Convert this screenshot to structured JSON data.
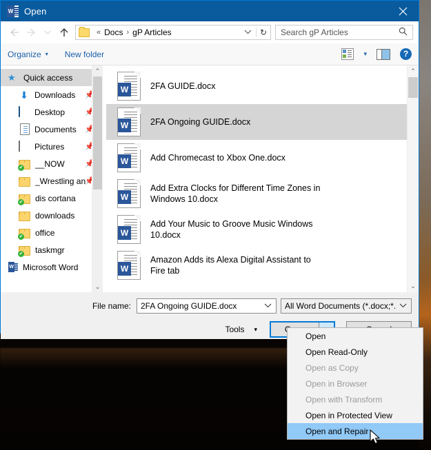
{
  "window": {
    "title": "Open",
    "app_icon": "word-icon",
    "close_icon": "close-icon"
  },
  "address_bar": {
    "back_icon": "back-arrow-icon",
    "forward_icon": "forward-arrow-icon",
    "recent_icon": "chevron-down-icon",
    "up_icon": "up-arrow-icon",
    "folder_icon": "folder-icon",
    "overflow": "«",
    "crumbs": [
      "Docs",
      "gP Articles"
    ],
    "separator": "›",
    "dropdown_icon": "chevron-down-icon",
    "refresh_icon": "refresh-icon",
    "refresh_glyph": "↻"
  },
  "search": {
    "placeholder": "Search gP Articles",
    "icon": "search-icon"
  },
  "command_bar": {
    "organize": "Organize",
    "new_folder": "New folder",
    "view_icon": "view-options-icon",
    "view_caret": "▾",
    "preview_pane_icon": "preview-pane-icon",
    "help_icon": "help-icon",
    "help_glyph": "?"
  },
  "sidebar": {
    "items": [
      {
        "label": "Quick access",
        "icon": "pin-star-icon",
        "selected": true,
        "indent": false,
        "pinned": false
      },
      {
        "label": "Downloads",
        "icon": "download-icon",
        "selected": false,
        "indent": true,
        "pinned": true
      },
      {
        "label": "Desktop",
        "icon": "desktop-icon",
        "selected": false,
        "indent": true,
        "pinned": true
      },
      {
        "label": "Documents",
        "icon": "documents-icon",
        "selected": false,
        "indent": true,
        "pinned": true
      },
      {
        "label": "Pictures",
        "icon": "pictures-icon",
        "selected": false,
        "indent": true,
        "pinned": true
      },
      {
        "label": "__NOW",
        "icon": "folder-sync-icon",
        "selected": false,
        "indent": true,
        "pinned": true
      },
      {
        "label": "_Wrestling an",
        "icon": "folder-icon",
        "selected": false,
        "indent": true,
        "pinned": true
      },
      {
        "label": "dis cortana",
        "icon": "folder-sync-icon",
        "selected": false,
        "indent": true,
        "pinned": false
      },
      {
        "label": "downloads",
        "icon": "folder-icon",
        "selected": false,
        "indent": true,
        "pinned": false
      },
      {
        "label": "office",
        "icon": "folder-sync-icon",
        "selected": false,
        "indent": true,
        "pinned": false
      },
      {
        "label": "taskmgr",
        "icon": "folder-sync-icon",
        "selected": false,
        "indent": true,
        "pinned": false
      },
      {
        "label": "Microsoft Word",
        "icon": "word-icon",
        "selected": false,
        "indent": false,
        "pinned": false
      }
    ],
    "pin_glyph": "📌",
    "scroll_up_glyph": "⌃",
    "scroll_down_glyph": "⌄"
  },
  "file_list": {
    "files": [
      {
        "name": "2FA GUIDE.docx",
        "icon": "word-document-icon",
        "selected": false
      },
      {
        "name": "2FA Ongoing GUIDE.docx",
        "icon": "word-document-icon",
        "selected": true
      },
      {
        "name": "Add Chromecast to Xbox One.docx",
        "icon": "word-document-icon",
        "selected": false
      },
      {
        "name": "Add Extra Clocks for Different Time Zones in Windows 10.docx",
        "icon": "word-document-icon",
        "selected": false
      },
      {
        "name": "Add Your Music to Groove Music Windows 10.docx",
        "icon": "word-document-icon",
        "selected": false
      },
      {
        "name": "Amazon Adds its Alexa Digital Assistant to Fire tab",
        "icon": "word-document-icon",
        "selected": false
      }
    ],
    "word_glyph": "W",
    "scroll_up_glyph": "⌃",
    "scroll_down_glyph": "⌄"
  },
  "footer": {
    "file_name_label": "File name:",
    "file_name_value": "2FA Ongoing GUIDE.docx",
    "file_name_caret": "⌄",
    "file_type_value": "All Word Documents (*.docx;*.d",
    "file_type_caret": "⌄",
    "tools_label": "Tools",
    "tools_caret": "▾",
    "open_label": "Open",
    "open_split_caret": "▾",
    "cancel_label": "Cancel"
  },
  "open_menu": {
    "items": [
      {
        "label": "Open",
        "disabled": false,
        "highlighted": false
      },
      {
        "label": "Open Read-Only",
        "disabled": false,
        "highlighted": false
      },
      {
        "label": "Open as Copy",
        "disabled": true,
        "highlighted": false
      },
      {
        "label": "Open in Browser",
        "disabled": true,
        "highlighted": false
      },
      {
        "label": "Open with Transform",
        "disabled": true,
        "highlighted": false
      },
      {
        "label": "Open in Protected View",
        "disabled": false,
        "highlighted": false
      },
      {
        "label": "Open and Repair",
        "disabled": false,
        "highlighted": true
      }
    ]
  },
  "colors": {
    "title_bar": "#0a5b9e",
    "accent": "#0078d7",
    "menu_highlight": "#91c9f7",
    "selection": "#d5d5d5",
    "link": "#1a5fa8",
    "word_blue": "#2b579a"
  },
  "cursor": {
    "icon": "mouse-pointer-icon"
  }
}
